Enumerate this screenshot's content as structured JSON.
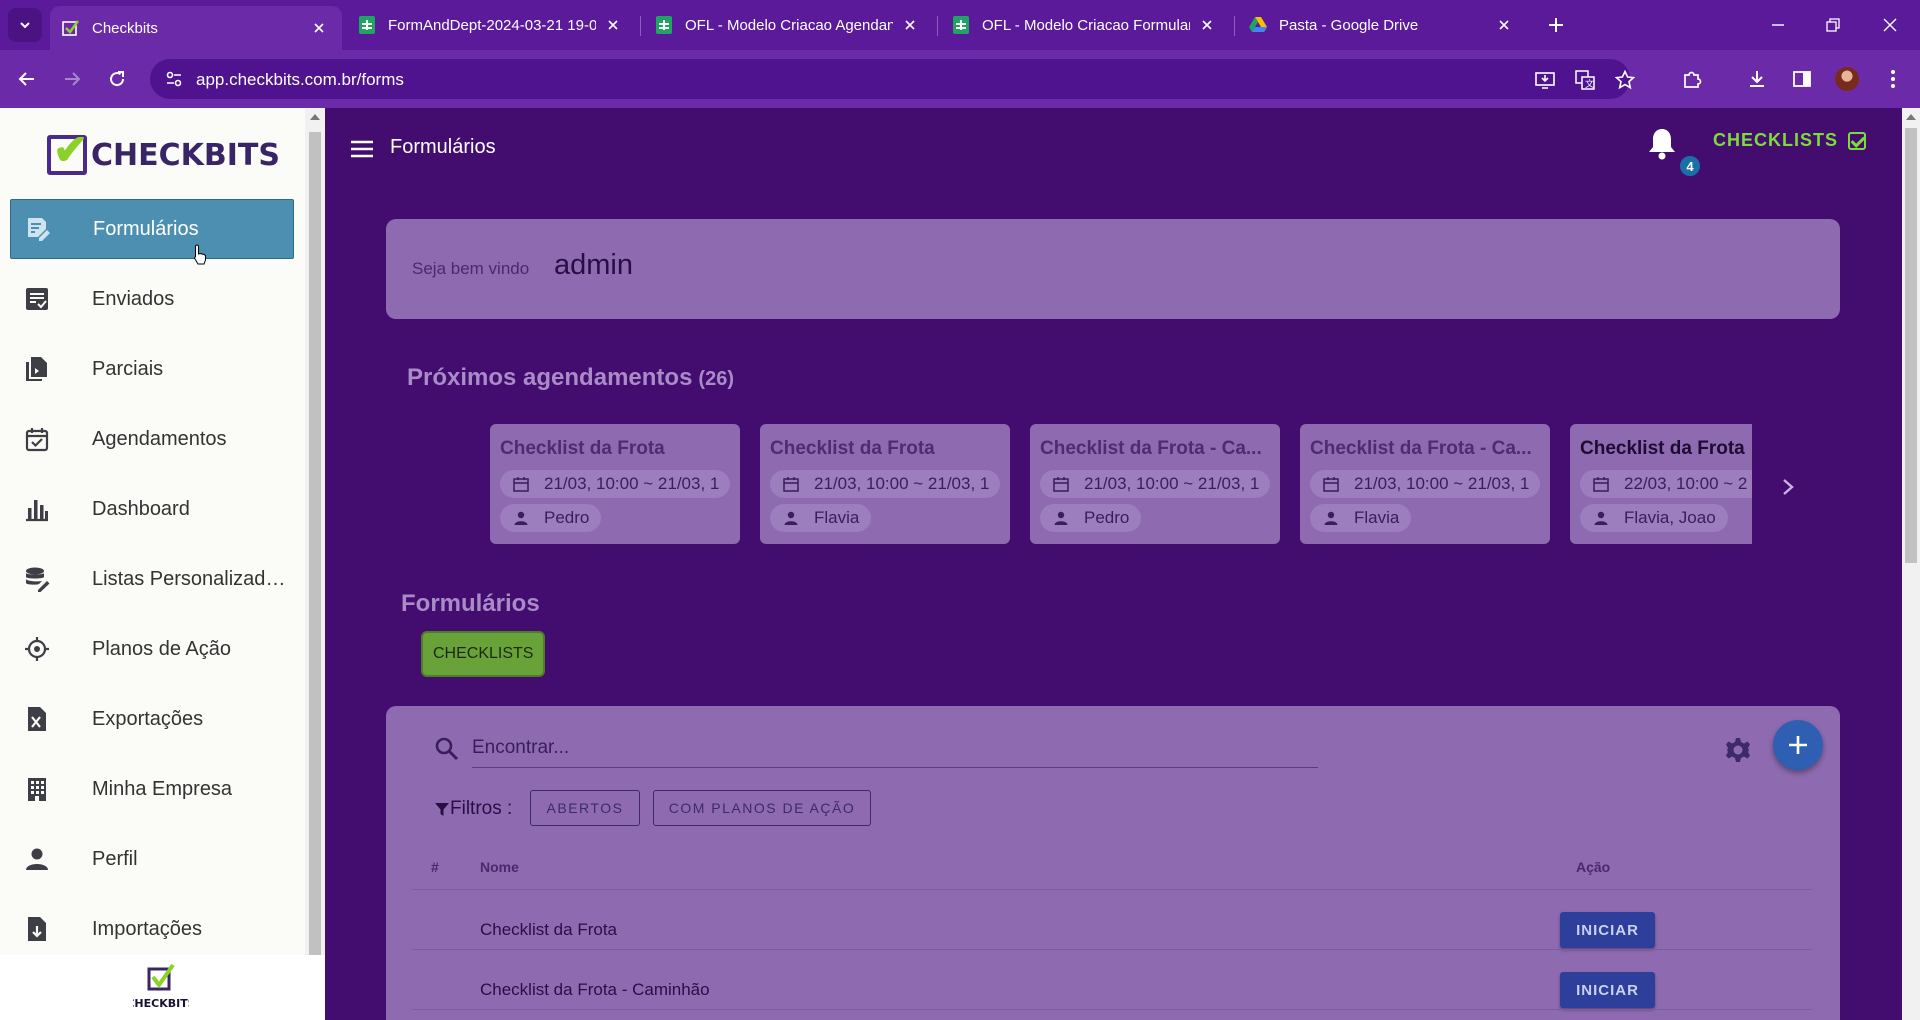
{
  "browser": {
    "tabs": [
      {
        "title": "Checkbits",
        "favicon": "checkbits-favicon",
        "active": true
      },
      {
        "title": "FormAndDept-2024-03-21 19-0",
        "favicon": "sheets-icon",
        "active": false
      },
      {
        "title": "OFL - Modelo Criacao Agendan",
        "favicon": "sheets-icon",
        "active": false
      },
      {
        "title": "OFL - Modelo Criacao Formular",
        "favicon": "sheets-icon",
        "active": false
      },
      {
        "title": "Pasta - Google Drive",
        "favicon": "google-drive-icon",
        "active": false
      }
    ],
    "url": "app.checkbits.com.br/forms"
  },
  "sidebar": {
    "brand": "CHECKBITS",
    "items": [
      {
        "label": "Formulários",
        "icon": "form-edit-icon",
        "active": true
      },
      {
        "label": "Enviados",
        "icon": "sent-list-icon",
        "active": false
      },
      {
        "label": "Parciais",
        "icon": "partial-file-icon",
        "active": false
      },
      {
        "label": "Agendamentos",
        "icon": "calendar-check-icon",
        "active": false
      },
      {
        "label": "Dashboard",
        "icon": "bar-chart-icon",
        "active": false
      },
      {
        "label": "Listas Personalizadas",
        "icon": "database-edit-icon",
        "active": false
      },
      {
        "label": "Planos de Ação",
        "icon": "target-icon",
        "active": false
      },
      {
        "label": "Exportações",
        "icon": "excel-file-icon",
        "active": false
      },
      {
        "label": "Minha Empresa",
        "icon": "building-icon",
        "active": false
      },
      {
        "label": "Perfil",
        "icon": "person-icon",
        "active": false
      },
      {
        "label": "Importações",
        "icon": "file-import-icon",
        "active": false
      }
    ],
    "footer_logo_text": "CHECKBITS"
  },
  "header": {
    "title": "Formulários",
    "notification_count": "4",
    "brand_label": "CHECKLISTS"
  },
  "welcome": {
    "label": "Seja bem vindo",
    "user": "admin"
  },
  "schedules": {
    "title": "Próximos agendamentos",
    "count": "(26)",
    "cards": [
      {
        "title": "Checklist da Frota",
        "time": "21/03, 10:00 ~ 21/03, 1",
        "people": "Pedro"
      },
      {
        "title": "Checklist da Frota",
        "time": "21/03, 10:00 ~ 21/03, 1",
        "people": "Flavia"
      },
      {
        "title": "Checklist da Frota - Ca...",
        "time": "21/03, 10:00 ~ 21/03, 1",
        "people": "Pedro"
      },
      {
        "title": "Checklist da Frota - Ca...",
        "time": "21/03, 10:00 ~ 21/03, 1",
        "people": "Flavia"
      },
      {
        "title": "Checklist da Frota",
        "time": "22/03, 10:00 ~ 2",
        "people": "Flavia, Joao"
      }
    ]
  },
  "forms": {
    "title": "Formulários",
    "category": "CHECKLISTS",
    "search_placeholder": "Encontrar...",
    "filters_label": "Filtros :",
    "filters": [
      "ABERTOS",
      "COM PLANOS DE AÇÃO"
    ],
    "columns": {
      "index": "#",
      "name": "Nome",
      "action": "Ação"
    },
    "rows": [
      {
        "name": "Checklist da Frota",
        "action": "INICIAR"
      },
      {
        "name": "Checklist da Frota - Caminhão",
        "action": "INICIAR"
      }
    ]
  },
  "colors": {
    "accent_green": "#7ddc3a",
    "main_bg": "#430c6f",
    "card_bg": "#8e6bb1",
    "active_nav": "#4d8fb0",
    "primary_button": "#2d3f9a"
  }
}
